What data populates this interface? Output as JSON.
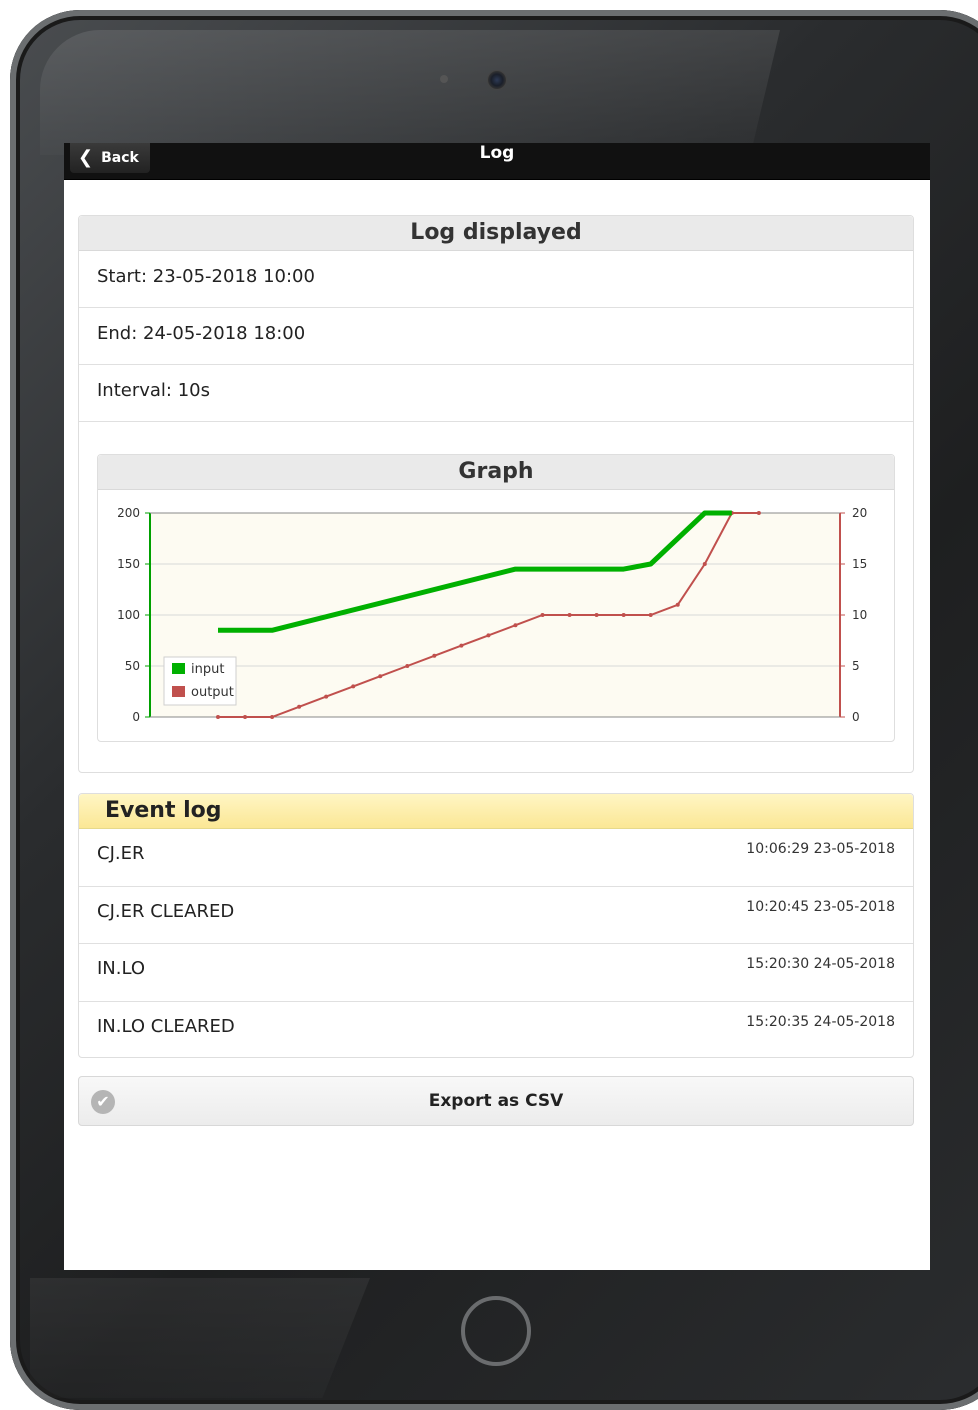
{
  "topbar": {
    "back_label": "Back",
    "title": "Log"
  },
  "log_panel": {
    "title": "Log displayed",
    "rows": [
      "Start: 23-05-2018 10:00",
      "End: 24-05-2018 18:00",
      "Interval: 10s"
    ]
  },
  "graph_panel": {
    "title": "Graph"
  },
  "chart_data": {
    "type": "line",
    "x": [
      1,
      2,
      3,
      4,
      5,
      6,
      7,
      8,
      9,
      10,
      11,
      12,
      13,
      14,
      15,
      16,
      17,
      18,
      19,
      20,
      21,
      22
    ],
    "series": [
      {
        "name": "input",
        "axis": "left",
        "color": "#00b000",
        "values": [
          85,
          85,
          85,
          null,
          null,
          null,
          null,
          null,
          null,
          null,
          null,
          145,
          145,
          145,
          145,
          145,
          150,
          175,
          200,
          200,
          null,
          null
        ]
      },
      {
        "name": "output",
        "axis": "right",
        "color": "#c0504d",
        "values": [
          0,
          0,
          0,
          1,
          2,
          3,
          4,
          5,
          6,
          7,
          8,
          9,
          10,
          10,
          10,
          10,
          10,
          11,
          15,
          20,
          20,
          null
        ]
      }
    ],
    "left_ticks": [
      "0",
      "50",
      "100",
      "150",
      "200"
    ],
    "right_ticks": [
      "0",
      "5",
      "10",
      "15",
      "20"
    ],
    "ylim_left": [
      0,
      200
    ],
    "ylim_right": [
      0,
      20
    ],
    "legend_placement": "bottom-left",
    "grid": true
  },
  "event_log": {
    "title": "Event log",
    "rows": [
      {
        "name": "CJ.ER",
        "time": "10:06:29 23-05-2018"
      },
      {
        "name": "CJ.ER CLEARED",
        "time": "10:20:45 23-05-2018"
      },
      {
        "name": "IN.LO",
        "time": "15:20:30 24-05-2018"
      },
      {
        "name": "IN.LO CLEARED",
        "time": "15:20:35 24-05-2018"
      }
    ]
  },
  "export": {
    "label": "Export as CSV",
    "icon": "check-icon"
  }
}
